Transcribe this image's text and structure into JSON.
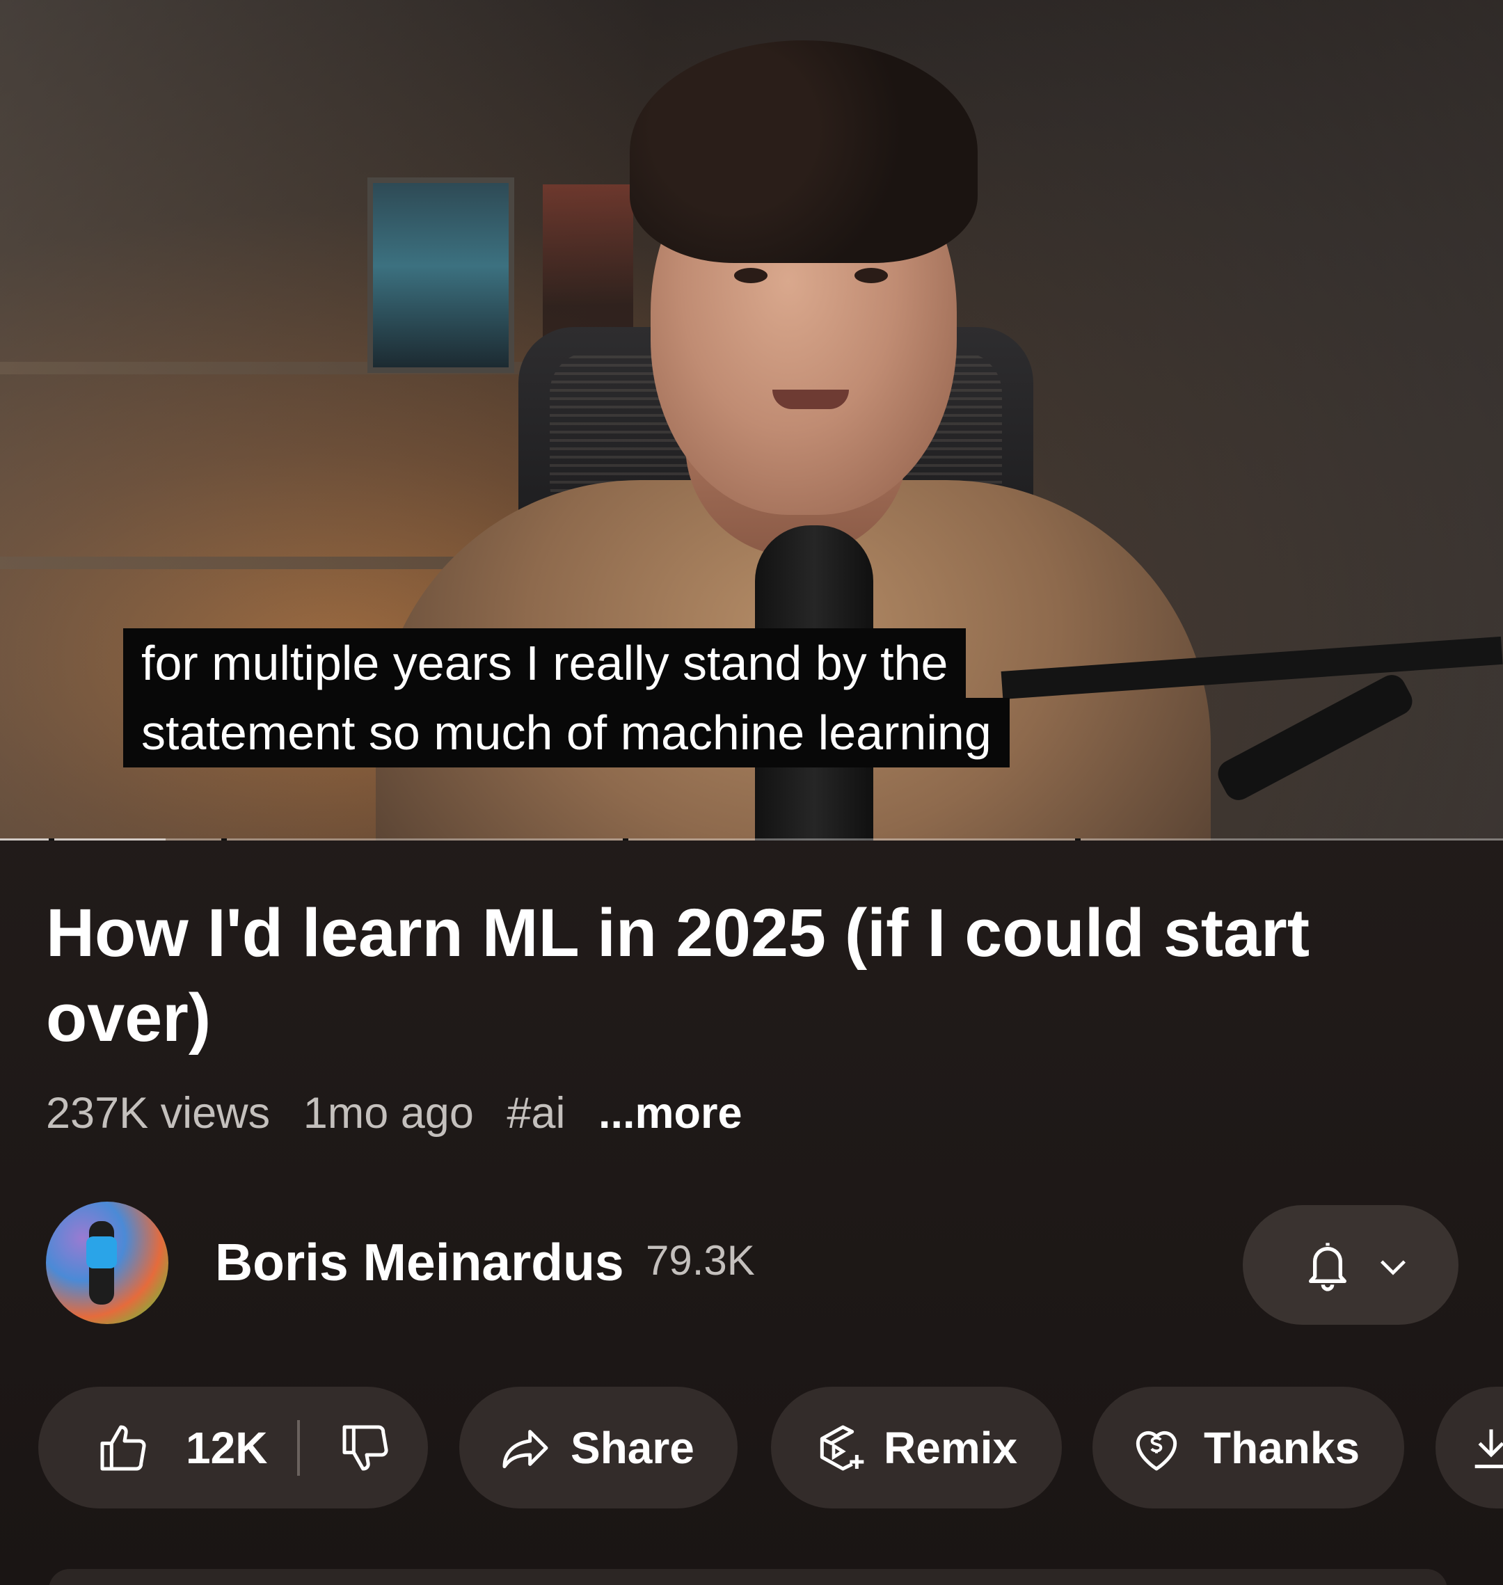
{
  "video": {
    "captions": [
      "for multiple years I really stand by the",
      "statement so much of machine learning"
    ],
    "progress_fraction": 0.11
  },
  "title": "How I'd learn ML in 2025 (if I could start over)",
  "meta": {
    "views": "237K views",
    "age": "1mo ago",
    "hashtag": "#ai",
    "more": "...more"
  },
  "channel": {
    "name": "Boris Meinardus",
    "subscribers": "79.3K",
    "avatar_icon": "channel-avatar",
    "notify_icon": "bell-icon",
    "dropdown_icon": "chevron-down-icon"
  },
  "actions": {
    "like_count": "12K",
    "share": "Share",
    "remix": "Remix",
    "thanks": "Thanks"
  },
  "colors": {
    "background": "#1b1614",
    "pill": "#332c2a",
    "secondary_text": "#c4c0bd",
    "caption_bg": "#080808"
  }
}
